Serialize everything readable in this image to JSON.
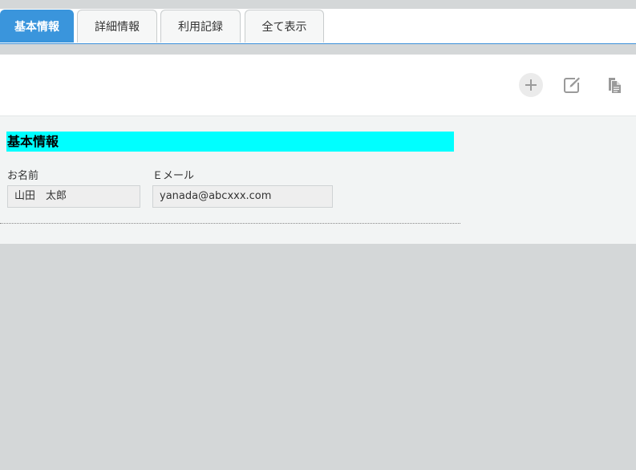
{
  "tabs": [
    {
      "label": "基本情報",
      "active": true
    },
    {
      "label": "詳細情報",
      "active": false
    },
    {
      "label": "利用記録",
      "active": false
    },
    {
      "label": "全て表示",
      "active": false
    }
  ],
  "toolbar": {
    "add_icon": "plus-icon",
    "edit_icon": "edit-icon",
    "copy_icon": "copy-icon"
  },
  "section": {
    "title": "基本情報",
    "name_label": "お名前",
    "name_value": "山田　太郎",
    "email_label": "Ｅメール",
    "email_value": "yanada@abcxxx.com"
  },
  "colors": {
    "tab_active": "#3a95dc",
    "section_title_bg": "#00ffff",
    "background": "#d4d7d8"
  }
}
